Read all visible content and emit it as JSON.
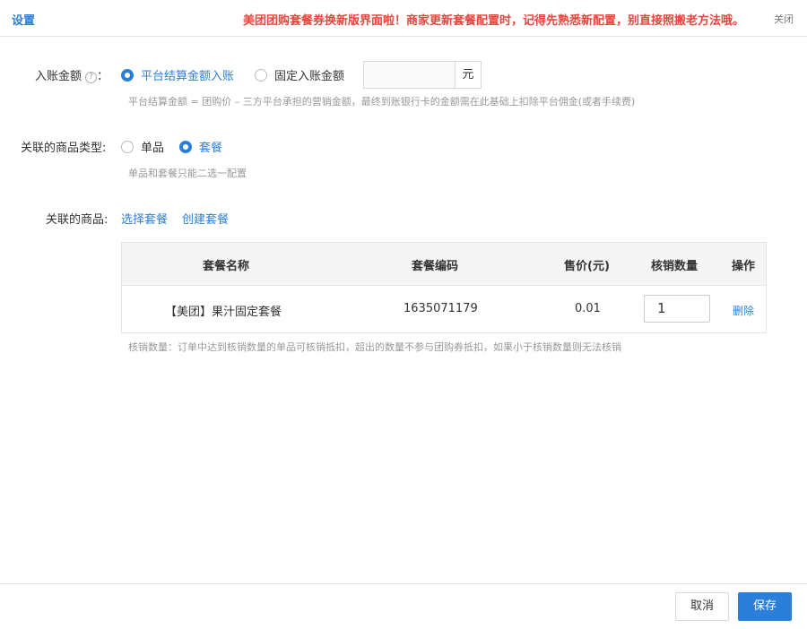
{
  "header": {
    "title": "设置",
    "notice": "美团团购套餐券换新版界面啦！商家更新套餐配置时，记得先熟悉新配置，别直接照搬老方法哦。",
    "close_label": "关闭"
  },
  "entry_amount": {
    "label": "入账金额",
    "help_glyph": "?",
    "colon": "：",
    "option_platform": "平台结算金额入账",
    "option_fixed": "固定入账金额",
    "amount_value": "",
    "unit": "元",
    "hint": "平台结算金额 = 团购价 – 三方平台承担的营销金额，最终到账银行卡的金额需在此基础上扣除平台佣金(或者手续费)",
    "selected": "platform"
  },
  "product_type": {
    "label": "关联的商品类型:",
    "option_single": "单品",
    "option_package": "套餐",
    "hint": "单品和套餐只能二选一配置",
    "selected": "package"
  },
  "products": {
    "label": "关联的商品:",
    "select_link": "选择套餐",
    "create_link": "创建套餐",
    "columns": {
      "name": "套餐名称",
      "code": "套餐编码",
      "price": "售价(元)",
      "qty": "核销数量",
      "action": "操作"
    },
    "rows": [
      {
        "name": "【美团】果汁固定套餐",
        "code": "1635071179",
        "price": "0.01",
        "qty": "1",
        "action": "删除"
      }
    ],
    "hint": "核销数量：订单中达到核销数量的单品可核销抵扣，超出的数量不参与团购券抵扣，如果小于核销数量则无法核销"
  },
  "footer": {
    "cancel_label": "取消",
    "save_label": "保存"
  },
  "colors": {
    "accent": "#2b7fd9",
    "notice": "#e8453c"
  }
}
